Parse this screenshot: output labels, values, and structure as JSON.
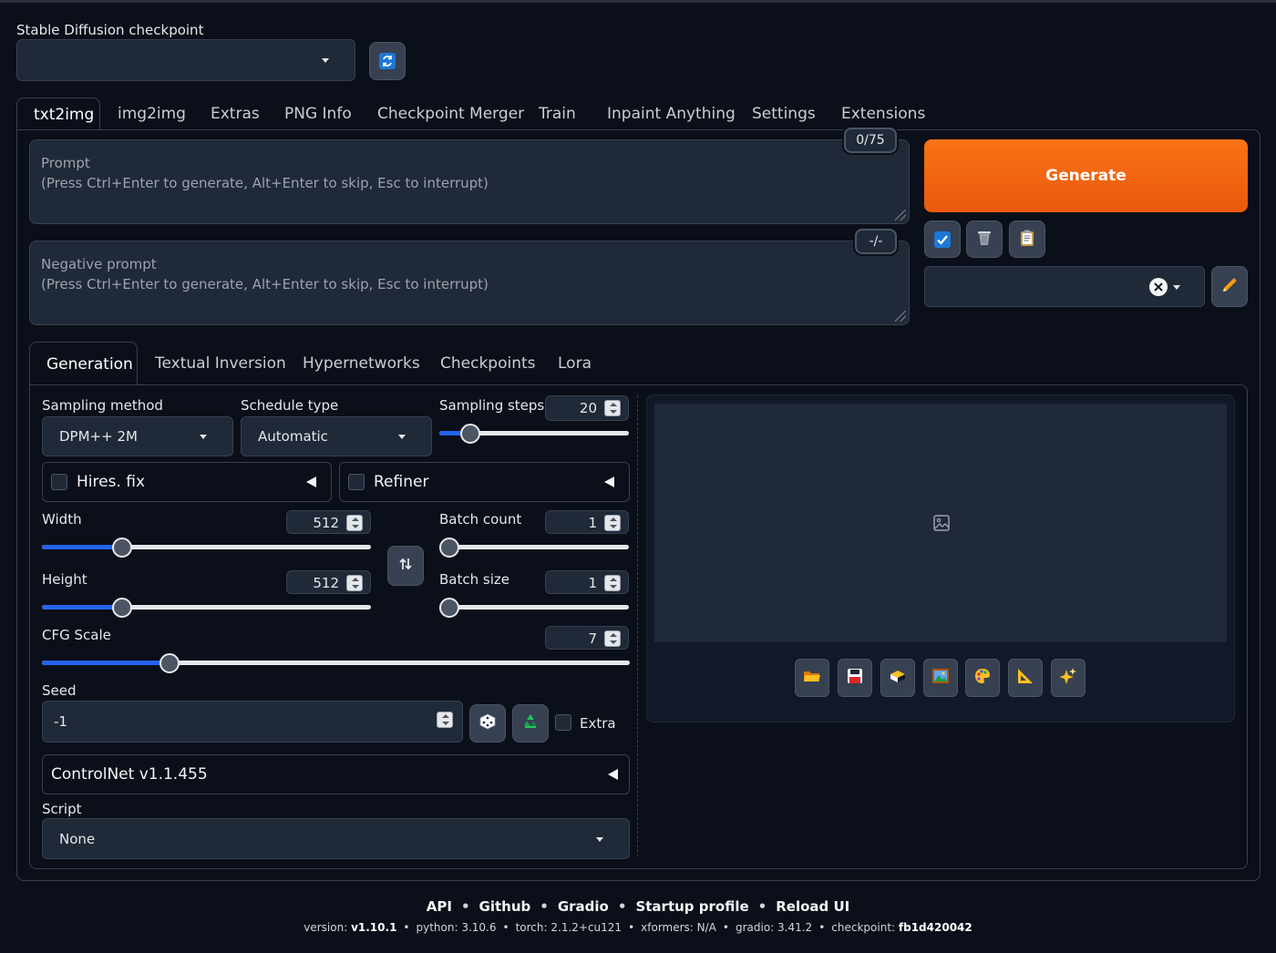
{
  "checkpoint": {
    "label": "Stable Diffusion checkpoint",
    "value": ""
  },
  "main_tabs": [
    "txt2img",
    "img2img",
    "Extras",
    "PNG Info",
    "Checkpoint Merger",
    "Train",
    "Inpaint Anything",
    "Settings",
    "Extensions"
  ],
  "prompt": {
    "placeholder_line1": "Prompt",
    "placeholder_line2": "(Press Ctrl+Enter to generate, Alt+Enter to skip, Esc to interrupt)",
    "token_counter": "0/75"
  },
  "negative_prompt": {
    "placeholder_line1": "Negative prompt",
    "placeholder_line2": "(Press Ctrl+Enter to generate, Alt+Enter to skip, Esc to interrupt)",
    "token_counter": "-/-"
  },
  "generate_label": "Generate",
  "sub_tabs": [
    "Generation",
    "Textual Inversion",
    "Hypernetworks",
    "Checkpoints",
    "Lora"
  ],
  "sampling": {
    "method_label": "Sampling method",
    "method_value": "DPM++ 2M",
    "schedule_label": "Schedule type",
    "schedule_value": "Automatic",
    "steps_label": "Sampling steps",
    "steps_value": "20"
  },
  "hires_fix": "Hires. fix",
  "refiner": "Refiner",
  "width": {
    "label": "Width",
    "value": "512"
  },
  "height": {
    "label": "Height",
    "value": "512"
  },
  "batch_count": {
    "label": "Batch count",
    "value": "1"
  },
  "batch_size": {
    "label": "Batch size",
    "value": "1"
  },
  "cfg": {
    "label": "CFG Scale",
    "value": "7"
  },
  "seed": {
    "label": "Seed",
    "value": "-1",
    "extra_label": "Extra"
  },
  "controlnet": "ControlNet v1.1.455",
  "script": {
    "label": "Script",
    "value": "None"
  },
  "footer": {
    "links": [
      "API",
      "Github",
      "Gradio",
      "Startup profile",
      "Reload UI"
    ],
    "version_label": "version:",
    "version": "v1.10.1",
    "python": "python: 3.10.6",
    "torch": "torch: 2.1.2+cu121",
    "xformers": "xformers: N/A",
    "gradio": "gradio: 3.41.2",
    "checkpoint_label": "checkpoint:",
    "checkpoint": "fb1d420042"
  }
}
